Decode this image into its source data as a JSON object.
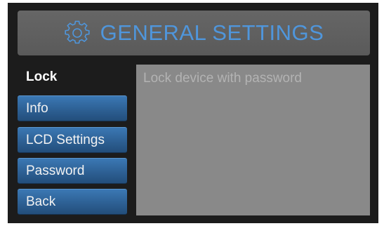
{
  "header": {
    "icon": "gear-icon",
    "title": "GENERAL SETTINGS"
  },
  "tabs": [
    {
      "label": "Lock",
      "active": true
    },
    {
      "label": "Info",
      "active": false
    },
    {
      "label": "LCD Settings",
      "active": false
    },
    {
      "label": "Password",
      "active": false
    },
    {
      "label": "Back",
      "active": false
    }
  ],
  "content": {
    "message": "Lock device with password"
  },
  "colors": {
    "accent": "#4f96dc",
    "button": "#2c5e91",
    "panel": "#898989",
    "frame": "#1c1c1c"
  }
}
